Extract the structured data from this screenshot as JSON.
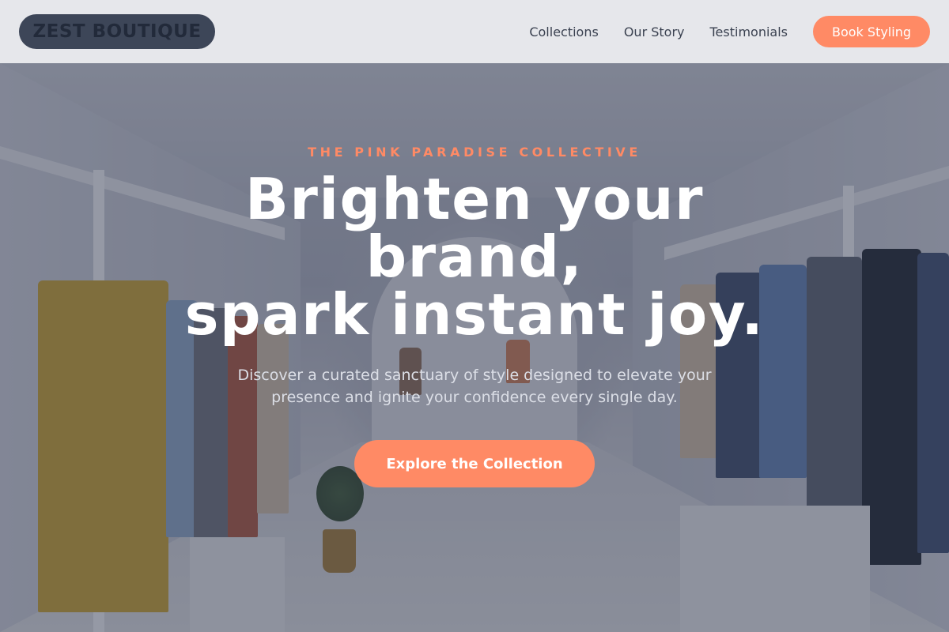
{
  "header": {
    "logo": "ZEST BOUTIQUE",
    "nav": [
      {
        "label": "Collections"
      },
      {
        "label": "Our Story"
      },
      {
        "label": "Testimonials"
      }
    ],
    "cta_label": "Book Styling"
  },
  "hero": {
    "eyebrow": "THE PINK PARADISE COLLECTIVE",
    "headline_lines": [
      "Brighten your",
      "brand,",
      "spark instant joy."
    ],
    "subtext_lines": [
      "Discover a curated sanctuary of style designed to elevate your",
      "presence and ignite your confidence every single day."
    ],
    "cta_label": "Explore the Collection",
    "background": "boutique-clothing-racks-photo"
  },
  "colors": {
    "accent": "#ff8a65",
    "logo_bg": "#3d4658",
    "header_bg": "#ecedf0",
    "overlay": "#2d344a"
  }
}
